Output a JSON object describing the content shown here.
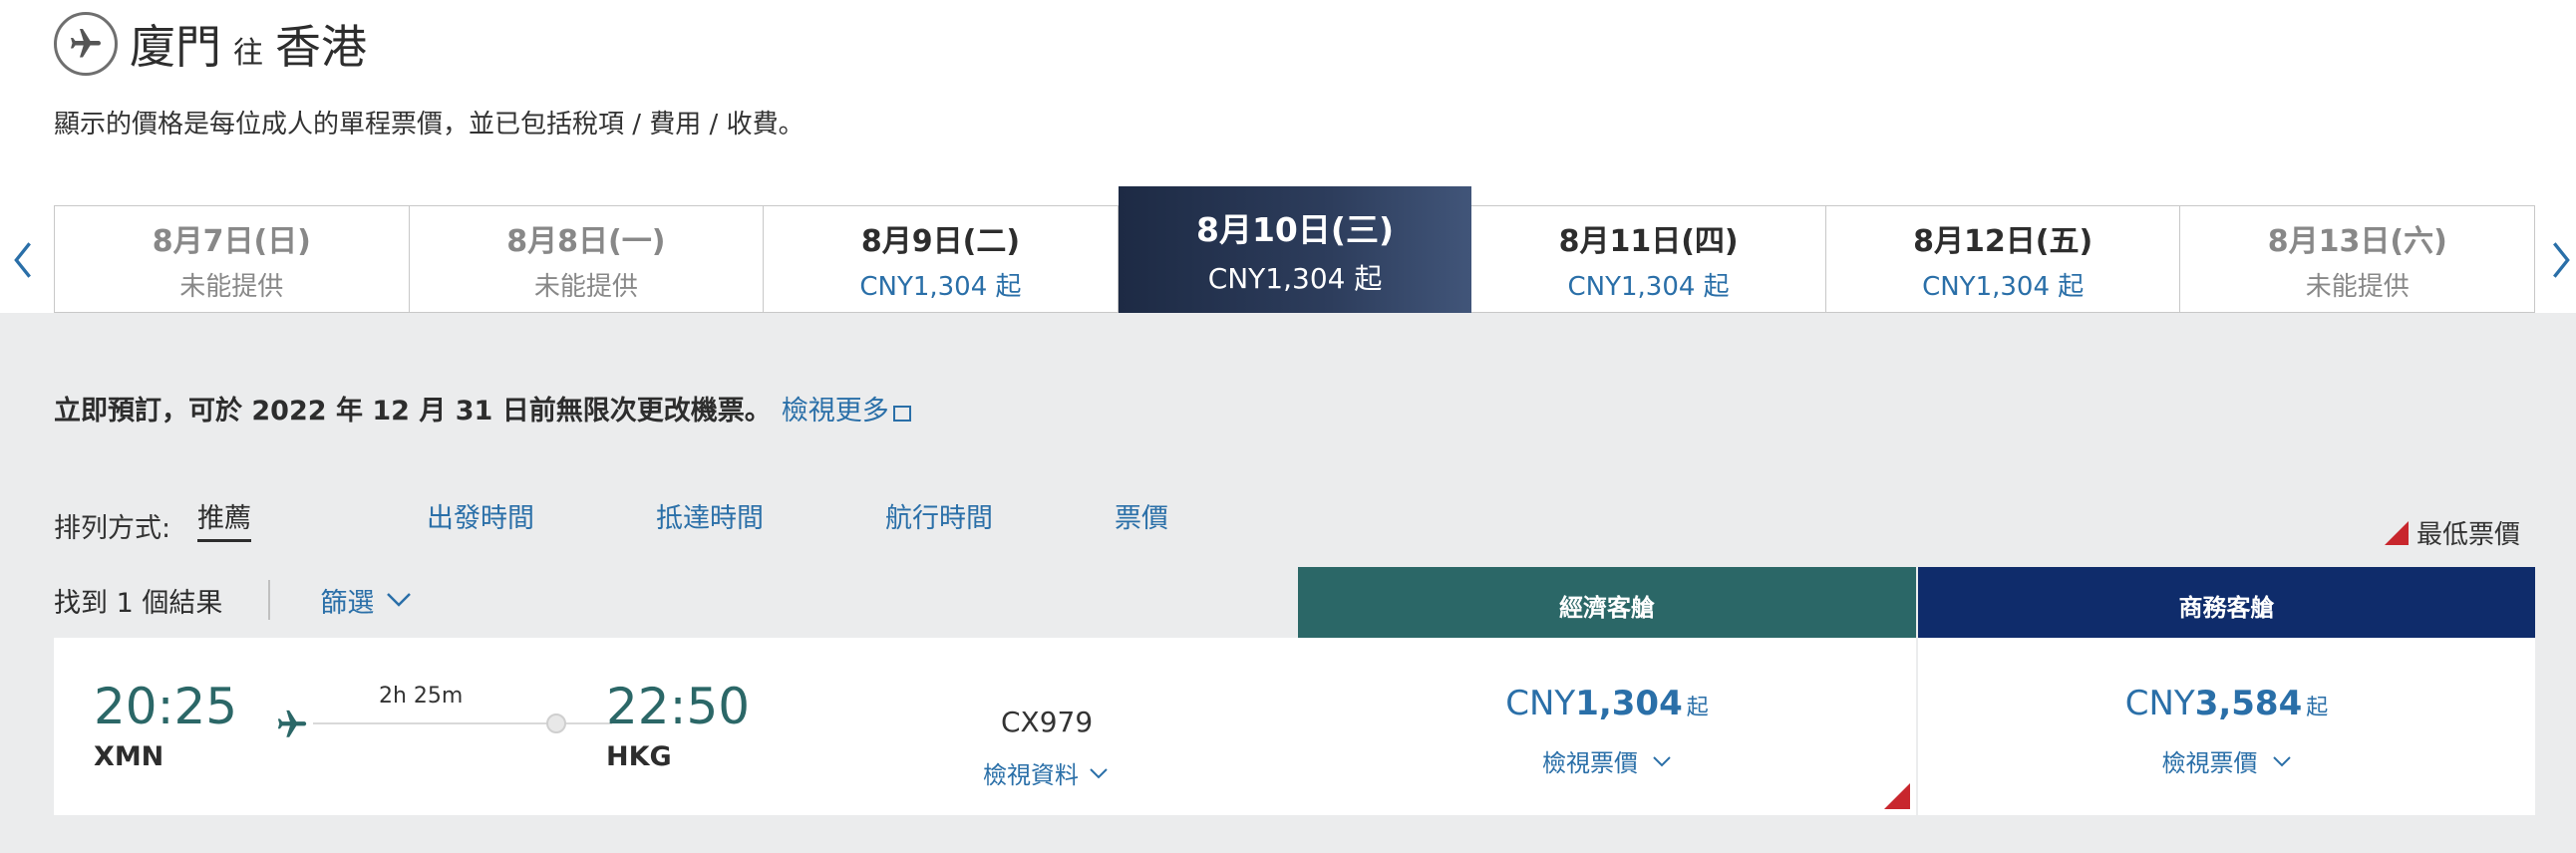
{
  "header": {
    "origin": "廈門",
    "separator": "往",
    "destination": "香港",
    "price_note": "顯示的價格是每位成人的單程票價，並已包括稅項 / 費用 / 收費。"
  },
  "date_strip": [
    {
      "date": "8月7日(日)",
      "price": "未能提供",
      "available": false
    },
    {
      "date": "8月8日(一)",
      "price": "未能提供",
      "available": false
    },
    {
      "date": "8月9日(二)",
      "price": "CNY1,304 起",
      "available": true
    },
    {
      "date": "8月10日(三)",
      "price": "CNY1,304 起",
      "available": true,
      "selected": true
    },
    {
      "date": "8月11日(四)",
      "price": "CNY1,304 起",
      "available": true
    },
    {
      "date": "8月12日(五)",
      "price": "CNY1,304 起",
      "available": true
    },
    {
      "date": "8月13日(六)",
      "price": "未能提供",
      "available": false
    }
  ],
  "promo": {
    "text": "立即預訂，可於 2022 年 12 月 31 日前無限次更改機票。",
    "link": "檢視更多"
  },
  "sort": {
    "label": "排列方式:",
    "options": [
      "推薦",
      "出發時間",
      "抵達時間",
      "航行時間",
      "票價"
    ],
    "active": "推薦"
  },
  "lowest_fare_legend": "最低票價",
  "results": {
    "count_text": "找到 1 個結果",
    "filter_label": "篩選"
  },
  "cabins": {
    "economy": "經濟客艙",
    "business": "商務客艙"
  },
  "flight": {
    "depart_time": "20:25",
    "depart_code": "XMN",
    "duration": "2h 25m",
    "arrive_time": "22:50",
    "arrive_code": "HKG",
    "flight_number": "CX979",
    "details_link": "檢視資料"
  },
  "fares": {
    "economy": {
      "currency": "CNY",
      "amount": "1,304",
      "from": "起",
      "view": "檢視票價"
    },
    "business": {
      "currency": "CNY",
      "amount": "3,584",
      "from": "起",
      "view": "檢視票價"
    }
  },
  "colors": {
    "link": "#2a6fa8",
    "economy_header": "#2b6767",
    "business_header": "#0f2c6b",
    "lowest_marker": "#c8262d",
    "panel_bg": "#ebeced"
  }
}
